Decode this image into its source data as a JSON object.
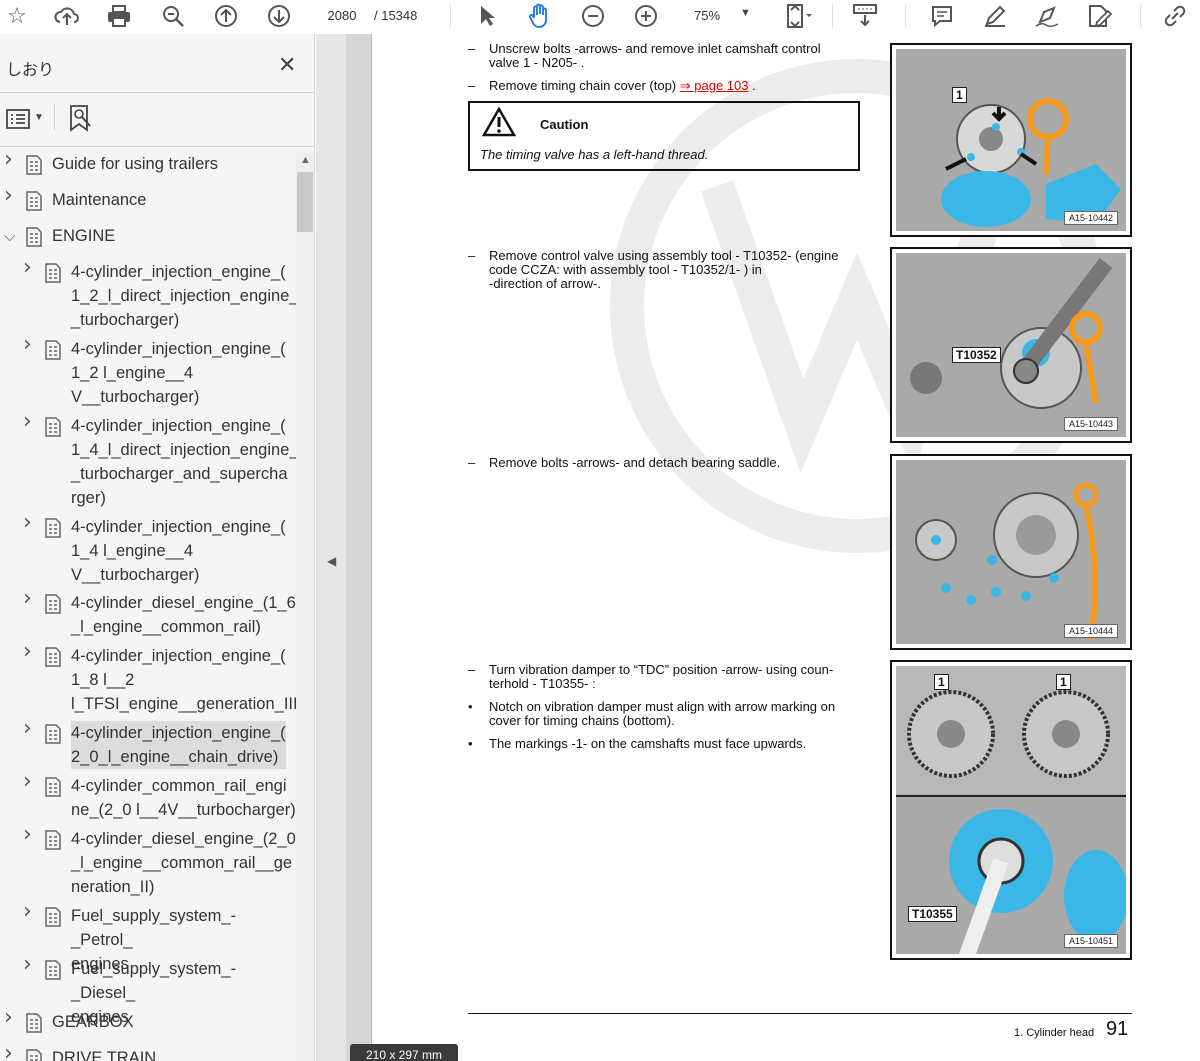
{
  "toolbar": {
    "page_current": "2080",
    "page_total": "/  15348",
    "zoom": "75%",
    "icons": [
      "star-icon",
      "upload-cloud-icon",
      "print-icon",
      "zoom-search-icon",
      "page-up-icon",
      "page-down-icon",
      "select-cursor-icon",
      "hand-tool-icon",
      "zoom-out-icon",
      "zoom-in-icon",
      "fit-page-icon",
      "scroll-mode-icon",
      "comment-icon",
      "highlight-pen-icon",
      "draw-icon",
      "edit-text-icon",
      "share-link-icon"
    ]
  },
  "sidebar": {
    "title": "しおり",
    "close": "✕",
    "bookmarks": [
      {
        "label": "Guide for using trailers",
        "level": 0,
        "expanded": false
      },
      {
        "label": "Maintenance",
        "level": 0,
        "expanded": false
      },
      {
        "label": "ENGINE",
        "level": 0,
        "expanded": true
      },
      {
        "label": "4-cylinder_injection_engine_(\n1_2_l_direct_injection_engine_\n_turbocharger)",
        "level": 1,
        "expanded": false
      },
      {
        "label": "4-cylinder_injection_engine_(\n1_2 l_engine__4\nV__turbocharger)",
        "level": 1,
        "expanded": false
      },
      {
        "label": "4-cylinder_injection_engine_(\n1_4_l_direct_injection_engine_\n_turbocharger_and_supercha\nrger)",
        "level": 1,
        "expanded": false
      },
      {
        "label": "4-cylinder_injection_engine_(\n1_4 l_engine__4\nV__turbocharger)",
        "level": 1,
        "expanded": false
      },
      {
        "label": "4-cylinder_diesel_engine_(1_6\n_l_engine__common_rail)",
        "level": 1,
        "expanded": false
      },
      {
        "label": "4-cylinder_injection_engine_(\n1_8 l__2\nl_TFSI_engine__generation_III)",
        "level": 1,
        "expanded": false
      },
      {
        "label": "4-cylinder_injection_engine_(\n2_0_l_engine__chain_drive)",
        "level": 1,
        "expanded": false,
        "selected": true
      },
      {
        "label": "4-cylinder_common_rail_engi\nne_(2_0 l__4V__turbocharger)",
        "level": 1,
        "expanded": false
      },
      {
        "label": "4-cylinder_diesel_engine_(2_0\n_l_engine__common_rail__ge\nneration_II)",
        "level": 1,
        "expanded": false
      },
      {
        "label": "Fuel_supply_system_-_Petrol_\nengines",
        "level": 1,
        "expanded": false
      },
      {
        "label": "Fuel_supply_system_-_Diesel_\nengines",
        "level": 1,
        "expanded": false
      },
      {
        "label": "GEARBOX",
        "level": 0,
        "expanded": false
      },
      {
        "label": "DRIVE TRAIN",
        "level": 0,
        "expanded": false
      }
    ]
  },
  "page_size": "210 x 297 mm",
  "doc": {
    "step1": "Unscrew bolts -arrows- and remove inlet camshaft control\nvalve 1 - N205- .",
    "step2_text": "Remove timing chain cover (top) ",
    "step2_link": "⇒ page 103",
    "step2_end": " .",
    "caution_title": "Caution",
    "caution_body": "The timing valve has a left-hand thread.",
    "step3": "Remove control valve using assembly tool - T10352- (engine\ncode CCZA: with assembly tool - T10352/1- ) in\n-direction of arrow-.",
    "step4": "Remove bolts -arrows- and detach bearing saddle.",
    "step5": "Turn vibration damper to “TDC” position -arrow- using coun-\nterhold - T10355- :",
    "bullet1": "Notch on vibration damper must align with arrow marking on\ncover for timing chains (bottom).",
    "bullet2": "The markings -1- on the camshafts must face upwards.",
    "dash": "–",
    "bullet": "•",
    "figs": [
      {
        "code": "A15-10442",
        "labels": [
          "1"
        ]
      },
      {
        "code": "A15-10443",
        "labels": [
          "T10352"
        ]
      },
      {
        "code": "A15-10444",
        "labels": []
      },
      {
        "code": "A15-10451",
        "labels": [
          "1",
          "1",
          "T10355"
        ]
      }
    ],
    "footer_section": "1. Cylinder head",
    "footer_page": "91"
  }
}
